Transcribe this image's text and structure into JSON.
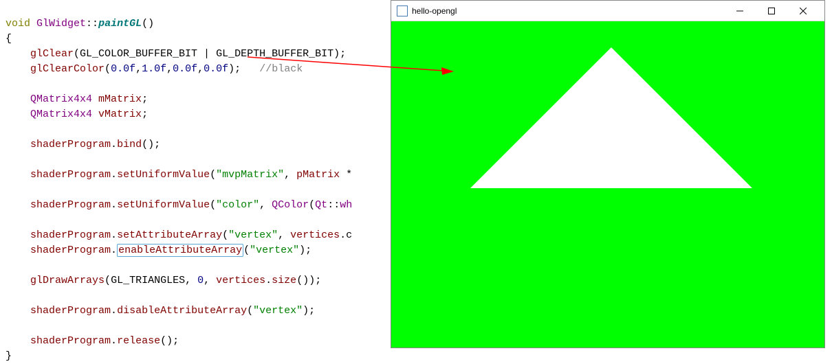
{
  "code": {
    "kw_void": "void",
    "class_name": "GlWidget",
    "scope": "::",
    "method_name": "paintGL",
    "parens_empty": "()",
    "brace_open": "{",
    "brace_close": "}",
    "glClear": "glClear",
    "glClear_args": "(GL_COLOR_BUFFER_BIT | GL_DEPTH_BUFFER_BIT);",
    "glClearColor": "glClearColor",
    "glClearColor_open": "(",
    "n0": "0.0f",
    "n1": "1.0f",
    "comma": ",",
    "glClearColor_close": ");",
    "comment_black": "//black",
    "qmatrix": "QMatrix4x4",
    "mMatrix": "mMatrix",
    "vMatrix": "vMatrix",
    "semi": ";",
    "shaderProgram": "shaderProgram",
    "dot": ".",
    "bind": "bind",
    "setUniformValue": "setUniformValue",
    "mvpMatrix_str": "\"mvpMatrix\"",
    "pMatrix": "pMatrix",
    "mvp_tail": " *",
    "color_str": "\"color\"",
    "qcolor": "QColor",
    "qt_ns": "Qt",
    "qt_white": "wh",
    "setAttributeArray": "setAttributeArray",
    "vertex_str": "\"vertex\"",
    "vertices": "vertices",
    "vertices_tail": ".c",
    "enableAttributeArray": "enableAttributeArray",
    "eaa_close": "(",
    "eaa_end": ");",
    "glDrawArrays": "glDrawArrays",
    "gl_triangles": "GL_TRIANGLES",
    "zero": "0",
    "size": "size",
    "size_call": "());",
    "disableAttributeArray": "disableAttributeArray",
    "release": "release",
    "open_paren": "(",
    "close_parensemi": ");",
    "indent1": "    ",
    "space": " ",
    "comma_sp": ", "
  },
  "window": {
    "title": "hello-opengl"
  }
}
